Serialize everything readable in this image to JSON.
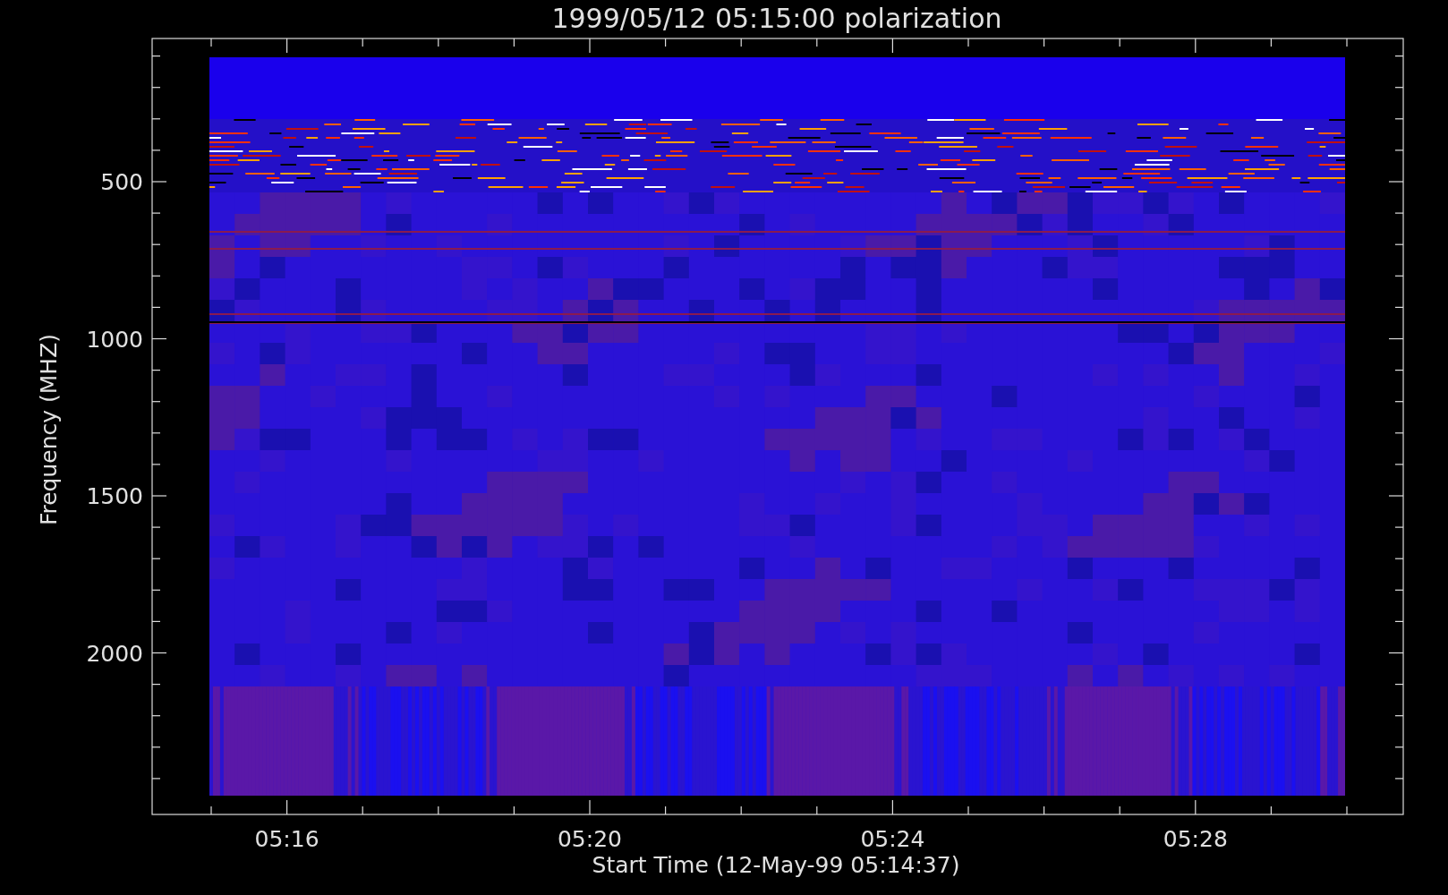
{
  "title": "1999/05/12 05:15:00 polarization",
  "y_axis": {
    "label": "Frequency (MHZ)",
    "tick_labels": [
      "500",
      "1000",
      "1500",
      "2000"
    ]
  },
  "x_axis": {
    "label": "Start Time (12-May-99 05:14:37)",
    "tick_labels": [
      "05:16",
      "05:20",
      "05:24",
      "05:28"
    ]
  }
}
